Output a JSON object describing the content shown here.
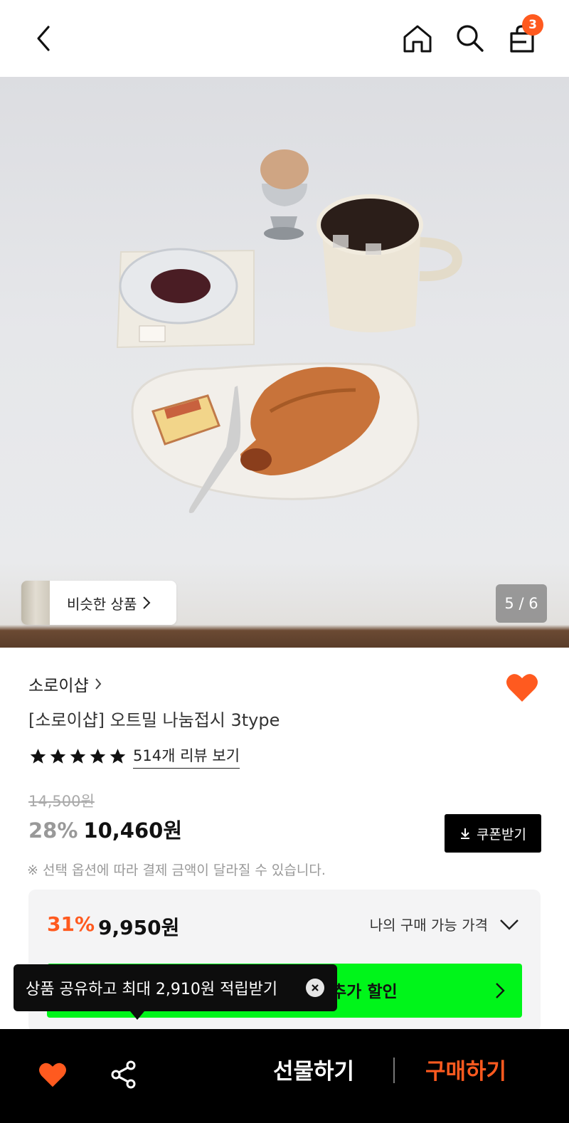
{
  "header": {
    "cart_count": "3"
  },
  "hero": {
    "similar_label": "비슷한 상품",
    "page_indicator": "5 / 6"
  },
  "product": {
    "brand": "소로이샵",
    "title": "[소로이샵] 오트밀 나눔접시 3type",
    "rating_stars": 5,
    "review_link": "514개 리뷰 보기",
    "original_price": "14,500원",
    "discount_rate": "28%",
    "sale_price": "10,460원",
    "coupon_label": "쿠폰받기",
    "notice": "※ 선택 옵션에 따라 결제 금액이 달라질 수 있습니다."
  },
  "benefit": {
    "rate": "31%",
    "price": "9,950원",
    "toggle_label": "나의 구매 가능 가격",
    "banner_text": "추가 할인",
    "banner_color": "#00f51a"
  },
  "tooltip": {
    "text": "상품 공유하고 최대 2,910원 적립받기"
  },
  "bottom_bar": {
    "gift_label": "선물하기",
    "buy_label": "구매하기"
  },
  "colors": {
    "accent": "#ff5a1f",
    "dark": "#000000"
  }
}
